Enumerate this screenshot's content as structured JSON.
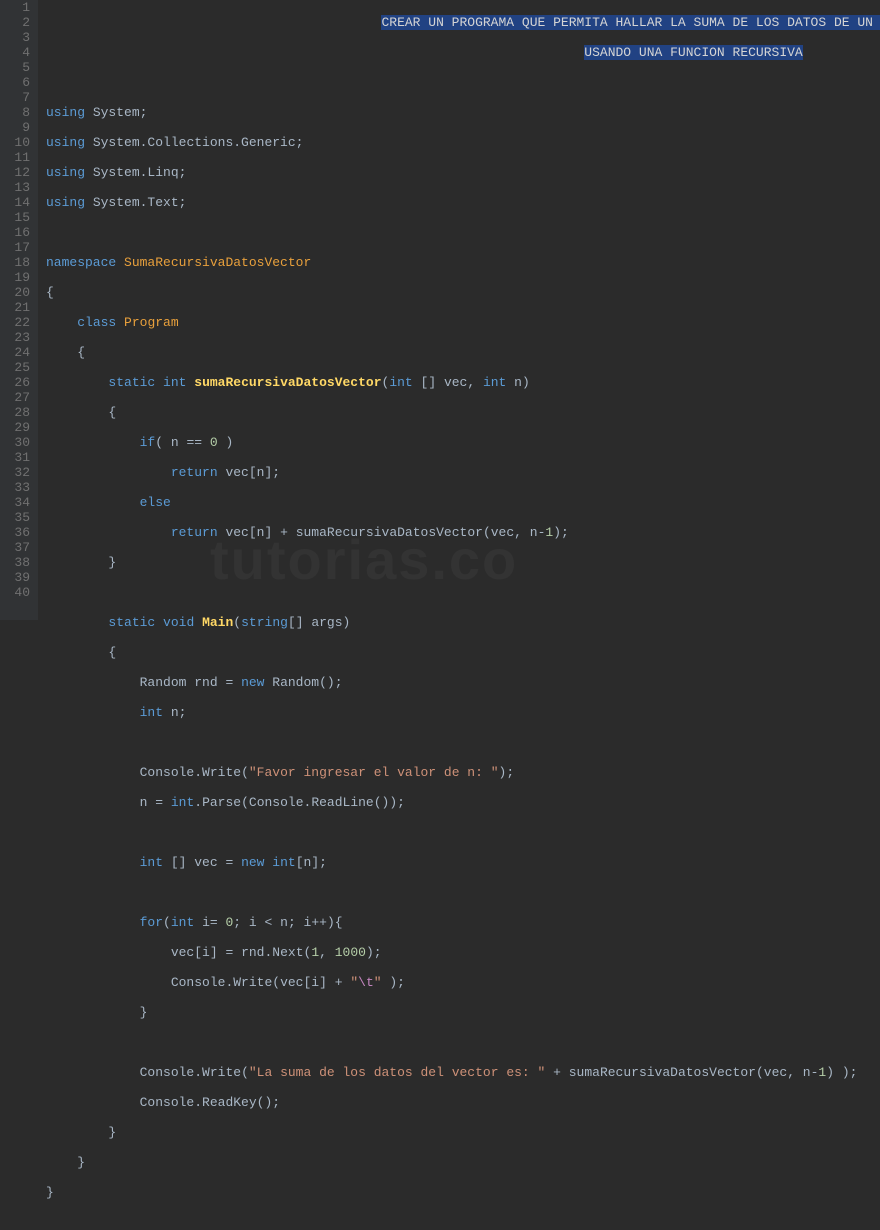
{
  "editor": {
    "line_count": 40,
    "selection_line1": "CREAR UN PROGRAMA QUE PERMITA HALLAR LA SUMA DE LOS DATOS DE UN VECTOR",
    "selection_line2": "USANDO UNA FUNCION RECURSIVA"
  },
  "code": {
    "using": "using",
    "system": "System",
    "syscolgen": "System.Collections.Generic",
    "syslinq": "System.Linq",
    "systext": "System.Text",
    "namespace": "namespace",
    "ns_name": "SumaRecursivaDatosVector",
    "class": "class",
    "classname": "Program",
    "static": "static",
    "int": "int",
    "void": "void",
    "new": "new",
    "string_br": "string",
    "return": "return",
    "if": "if",
    "else": "else",
    "for": "for",
    "fn_suma": "sumaRecursivaDatosVector",
    "main": "Main",
    "vec": "vec",
    "n": "n",
    "args": "args",
    "rnd": "rnd",
    "Random": "Random",
    "Console": "Console",
    "Write": "Write",
    "ReadLine": "ReadLine",
    "ReadKey": "ReadKey",
    "Parse": "Parse",
    "Next": "Next",
    "i": "i",
    "zero": "0",
    "one": "1",
    "thousand": "1000",
    "str_prompt": "\"Favor ingresar el valor de n: \"",
    "str_result": "\"La suma de los datos del vector es: \"",
    "str_tab_open": "\"",
    "str_tab_esc": "\\t",
    "str_tab_close": "\""
  },
  "watermark": "tutorias.co"
}
